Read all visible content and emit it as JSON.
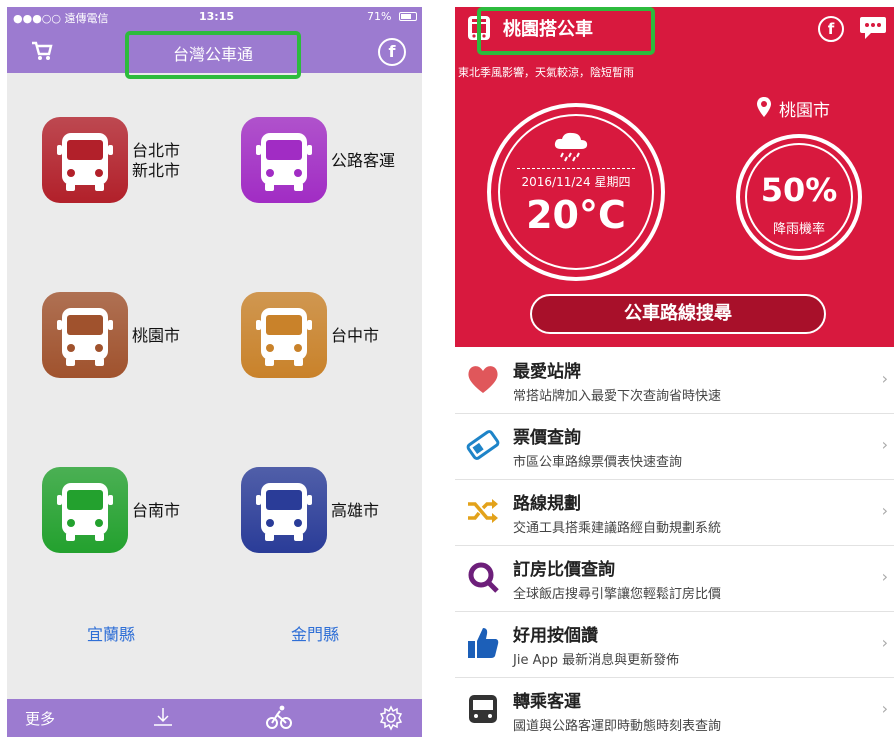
{
  "left": {
    "status": {
      "carrier": "●●●○○ 遠傳電信",
      "time": "13:15",
      "battery": "71%"
    },
    "nav": {
      "title": "台灣公車通"
    },
    "tiles": [
      {
        "label_lines": [
          "台北市",
          "新北市"
        ],
        "color": "#b2202a"
      },
      {
        "label_lines": [
          "公路客運"
        ],
        "color": "#a12cc4"
      },
      {
        "label_lines": [
          "桃園市"
        ],
        "color": "#a0522d"
      },
      {
        "label_lines": [
          "台中市"
        ],
        "color": "#c9822a"
      },
      {
        "label_lines": [
          "台南市"
        ],
        "color": "#23a12e"
      },
      {
        "label_lines": [
          "高雄市"
        ],
        "color": "#2a3c98"
      }
    ],
    "counties": [
      "宜蘭縣",
      "金門縣"
    ],
    "tabbar": {
      "more": "更多"
    }
  },
  "right": {
    "nav": {
      "title": "桃園搭公車"
    },
    "weather_note": "東北季風影響，天氣較涼，陰短暫雨",
    "location": "桃園市",
    "date": "2016/11/24 星期四",
    "temp": "20°C",
    "rain_pct": "50%",
    "rain_label": "降雨機率",
    "search_button": "公車路線搜尋",
    "menu": [
      {
        "title": "最愛站牌",
        "sub": "常搭站牌加入最愛下次查詢省時快速",
        "icon": "heart-icon",
        "color": "#e0575b"
      },
      {
        "title": "票價查詢",
        "sub": "市區公車路線票價表快速查詢",
        "icon": "ticket-icon",
        "color": "#1e84c8"
      },
      {
        "title": "路線規劃",
        "sub": "交通工具搭乘建議路經自動規劃系統",
        "icon": "shuffle-icon",
        "color": "#e3a21a"
      },
      {
        "title": "訂房比價查詢",
        "sub": "全球飯店搜尋引擎讓您輕鬆訂房比價",
        "icon": "search-icon",
        "color": "#6d1f7a"
      },
      {
        "title": "好用按個讚",
        "sub": "Jie App 最新消息與更新發佈",
        "icon": "thumbs-up-icon",
        "color": "#1c5fb8"
      },
      {
        "title": "轉乘客運",
        "sub": "國道與公路客運即時動態時刻表查詢",
        "icon": "coach-icon",
        "color": "#333333"
      }
    ]
  }
}
